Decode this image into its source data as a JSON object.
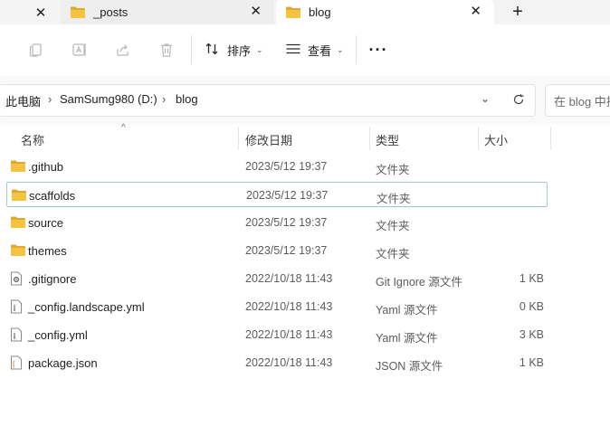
{
  "tabs": {
    "first_tab_close": "✕",
    "inactive_tab_label": "_posts",
    "active_tab_label": "blog",
    "close_glyph": "✕",
    "new_tab_glyph": "+"
  },
  "toolbar": {
    "icons": [
      "copy-icon",
      "rename-icon",
      "share-icon",
      "delete-icon"
    ],
    "sort_label": "排序",
    "view_label": "查看",
    "caret": "⌄",
    "more_label": "···"
  },
  "address": {
    "crumbs": [
      "此电脑",
      "SamSumg980 (D:)",
      "blog"
    ],
    "separator": "›",
    "dropdown_glyph": "⌄",
    "search_placeholder": "在 blog 中搜索"
  },
  "columns": {
    "name": "名称",
    "date": "修改日期",
    "type": "类型",
    "size": "大小",
    "sort_glyph": "^"
  },
  "files": [
    {
      "name": ".github",
      "date": "2023/5/12 19:37",
      "type": "文件夹",
      "size": "",
      "icon": "folder-icon"
    },
    {
      "name": "scaffolds",
      "date": "2023/5/12 19:37",
      "type": "文件夹",
      "size": "",
      "icon": "folder-icon"
    },
    {
      "name": "source",
      "date": "2023/5/12 19:37",
      "type": "文件夹",
      "size": "",
      "icon": "folder-icon"
    },
    {
      "name": "themes",
      "date": "2023/5/12 19:37",
      "type": "文件夹",
      "size": "",
      "icon": "folder-icon"
    },
    {
      "name": ".gitignore",
      "date": "2022/10/18 11:43",
      "type": "Git Ignore 源文件",
      "size": "1 KB",
      "icon": "settings-file-icon"
    },
    {
      "name": "_config.landscape.yml",
      "date": "2022/10/18 11:43",
      "type": "Yaml 源文件",
      "size": "0 KB",
      "icon": "text-file-icon"
    },
    {
      "name": "_config.yml",
      "date": "2022/10/18 11:43",
      "type": "Yaml 源文件",
      "size": "3 KB",
      "icon": "text-file-icon"
    },
    {
      "name": "package.json",
      "date": "2022/10/18 11:43",
      "type": "JSON 源文件",
      "size": "1 KB",
      "icon": "json-file-icon"
    }
  ],
  "selected_row": 1,
  "colors": {
    "folder": "#f5c242",
    "folder_dark": "#e0a92b",
    "selection_border": "#9ecdd1"
  }
}
